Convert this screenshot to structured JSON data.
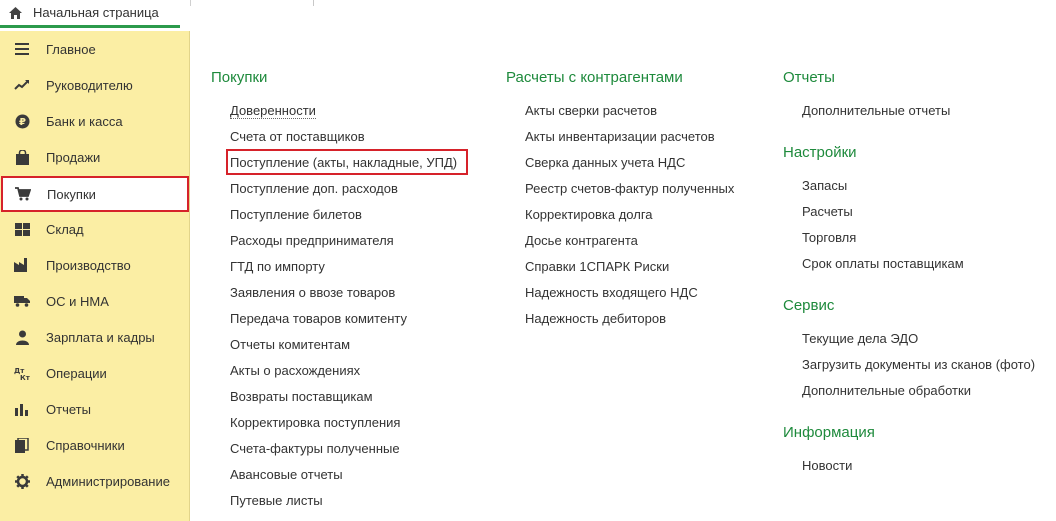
{
  "topbar": {
    "home_tab_label": "Начальная страница"
  },
  "sidebar": {
    "items": [
      {
        "label": "Главное",
        "icon": "menu-lines-icon"
      },
      {
        "label": "Руководителю",
        "icon": "trend-up-icon"
      },
      {
        "label": "Банк и касса",
        "icon": "ruble-coin-icon"
      },
      {
        "label": "Продажи",
        "icon": "shopping-bag-icon"
      },
      {
        "label": "Покупки",
        "icon": "shopping-cart-icon",
        "active": true
      },
      {
        "label": "Склад",
        "icon": "warehouse-grid-icon"
      },
      {
        "label": "Производство",
        "icon": "factory-icon"
      },
      {
        "label": "ОС и НМА",
        "icon": "truck-icon"
      },
      {
        "label": "Зарплата и кадры",
        "icon": "person-icon"
      },
      {
        "label": "Операции",
        "icon": "debit-credit-icon",
        "icon_text": "Дт Кт"
      },
      {
        "label": "Отчеты",
        "icon": "bar-chart-icon"
      },
      {
        "label": "Справочники",
        "icon": "book-icon"
      },
      {
        "label": "Администрирование",
        "icon": "gear-icon"
      }
    ]
  },
  "colors": {
    "accent_green": "#1e8a3c",
    "highlight_red": "#d6222a",
    "sidebar_bg": "#fbeea4"
  },
  "main": {
    "col1": {
      "title": "Покупки",
      "links": [
        "Доверенности",
        "Счета от поставщиков",
        "Поступление (акты, накладные, УПД)",
        "Поступление доп. расходов",
        "Поступление билетов",
        "Расходы предпринимателя",
        "ГТД по импорту",
        "Заявления о ввозе товаров",
        "Передача товаров комитенту",
        "Отчеты комитентам",
        "Акты о расхождениях",
        "Возвраты поставщикам",
        "Корректировка поступления",
        "Счета-фактуры полученные",
        "Авансовые отчеты",
        "Путевые листы"
      ]
    },
    "col2": {
      "title": "Расчеты с контрагентами",
      "links": [
        "Акты сверки расчетов",
        "Акты инвентаризации расчетов",
        "Сверка данных учета НДС",
        "Реестр счетов-фактур полученных",
        "Корректировка долга",
        "Досье контрагента",
        "Справки 1СПАРК Риски",
        "Надежность входящего НДС",
        "Надежность дебиторов"
      ]
    },
    "col3": {
      "sections": [
        {
          "title": "Отчеты",
          "links": [
            "Дополнительные отчеты"
          ]
        },
        {
          "title": "Настройки",
          "links": [
            "Запасы",
            "Расчеты",
            "Торговля",
            "Срок оплаты поставщикам"
          ]
        },
        {
          "title": "Сервис",
          "links": [
            "Текущие дела ЭДО",
            "Загрузить документы из сканов (фото)",
            "Дополнительные обработки"
          ]
        },
        {
          "title": "Информация",
          "links": [
            "Новости"
          ]
        }
      ]
    }
  }
}
